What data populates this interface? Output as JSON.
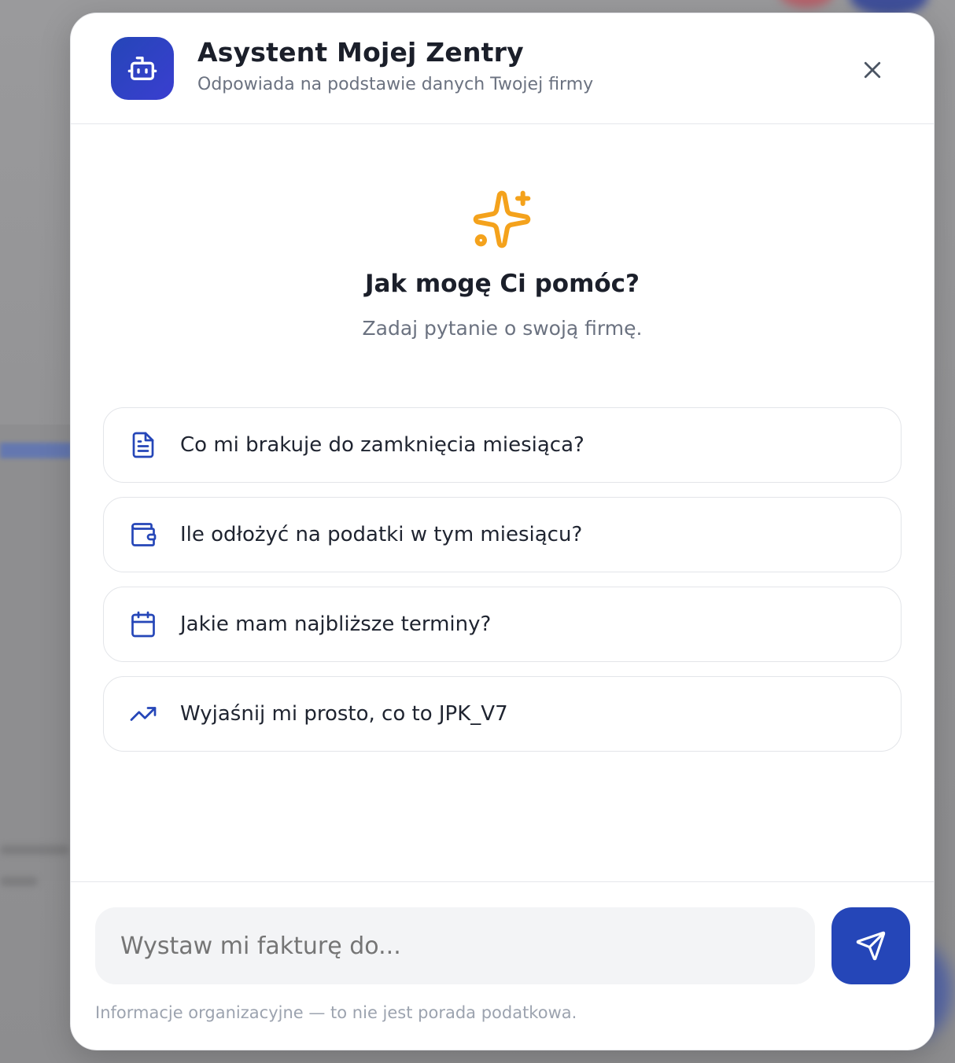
{
  "header": {
    "title": "Asystent Mojej Zentry",
    "subtitle": "Odpowiada na podstawie danych Twojej firmy",
    "avatar_icon": "bot-icon",
    "close_icon": "close-icon"
  },
  "hero": {
    "icon": "sparkles-icon",
    "title": "Jak mogę Ci pomóc?",
    "subtitle": "Zadaj pytanie o swoją firmę."
  },
  "suggestions": [
    {
      "icon": "document-icon",
      "label": "Co mi brakuje do zamknięcia miesiąca?"
    },
    {
      "icon": "wallet-icon",
      "label": "Ile odłożyć na podatki w tym miesiącu?"
    },
    {
      "icon": "calendar-icon",
      "label": "Jakie mam najbliższe terminy?"
    },
    {
      "icon": "trending-up-icon",
      "label": "Wyjaśnij mi prosto, co to JPK_V7"
    }
  ],
  "composer": {
    "placeholder": "Wystaw mi fakturę do...",
    "send_icon": "send-icon"
  },
  "disclaimer": "Informacje organizacyjne — to nie jest porada podatkowa.",
  "colors": {
    "accent": "#2546b8",
    "sparkle": "#f4a21c",
    "text_primary": "#1b1f2a",
    "text_muted": "#6b7280",
    "border": "#e3e5e9",
    "input_bg": "#f3f4f6"
  }
}
